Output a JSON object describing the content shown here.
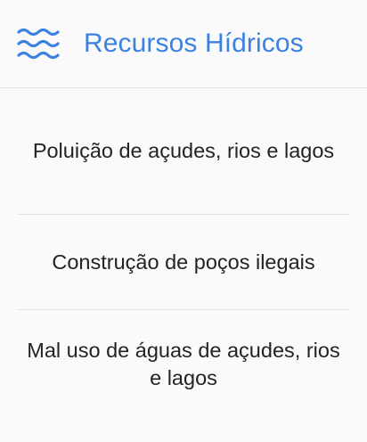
{
  "header": {
    "icon": "water-waves-icon",
    "title": "Recursos Hídricos",
    "accent_color": "#3b82e0"
  },
  "items": [
    {
      "label": "Poluição de açudes, rios e lagos"
    },
    {
      "label": "Construção de poços ilegais"
    },
    {
      "label": "Mal uso de águas de açudes, rios e lagos"
    }
  ]
}
